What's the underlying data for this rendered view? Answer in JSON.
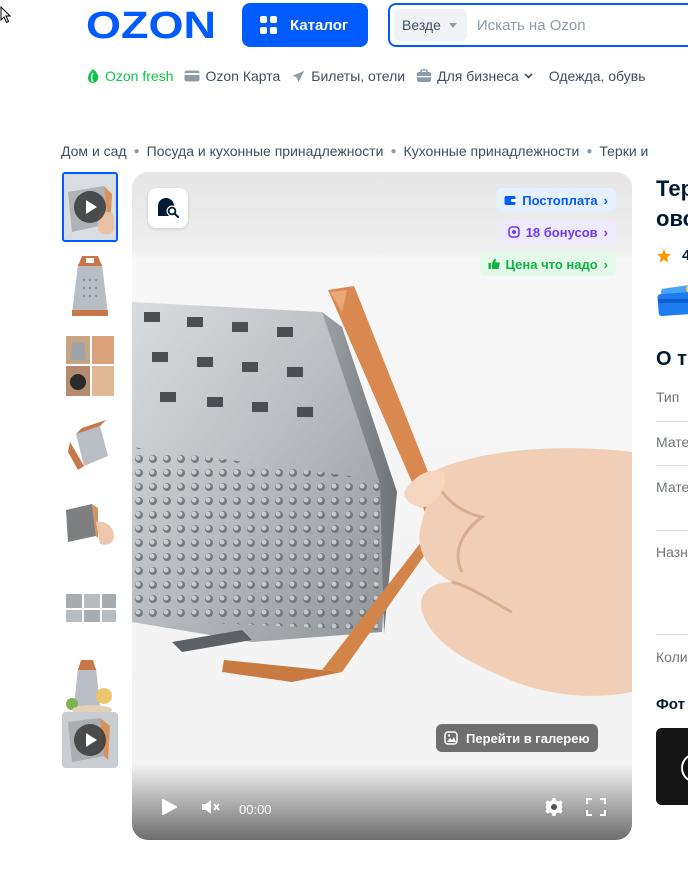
{
  "header": {
    "logo_text": "OZON",
    "catalog_label": "Каталог",
    "search": {
      "scope": "Везде",
      "placeholder": "Искать на Ozon"
    }
  },
  "nav": [
    {
      "label": "Ozon fresh",
      "icon": "fresh-icon"
    },
    {
      "label": "Ozon Карта",
      "icon": "card-icon"
    },
    {
      "label": "Билеты, отели",
      "icon": "plane-icon"
    },
    {
      "label": "Для бизнеса",
      "icon": "business-icon",
      "has_dropdown": true
    },
    {
      "label": "Одежда, обувь",
      "icon": ""
    }
  ],
  "breadcrumb": [
    "Дом и сад",
    "Посуда и кухонные принадлежности",
    "Кухонные принадлежности",
    "Терки и"
  ],
  "gallery": {
    "chips": {
      "postpay": "Постоплата",
      "bonus": "18 бонусов",
      "price": "Цена что надо"
    },
    "gallery_button": "Перейти в галерею",
    "video_time": "00:00",
    "thumbnails": [
      {
        "kind": "video",
        "active": true
      },
      {
        "kind": "image"
      },
      {
        "kind": "image"
      },
      {
        "kind": "image"
      },
      {
        "kind": "image"
      },
      {
        "kind": "image"
      },
      {
        "kind": "image"
      },
      {
        "kind": "video"
      }
    ]
  },
  "product": {
    "title_line1": "Тер",
    "title_line2": "ово",
    "rating": "4",
    "about_heading": "О т",
    "specs": [
      "Тип",
      "Мате",
      "Мате",
      "Назн",
      "Коли"
    ],
    "photos_heading": "Фот"
  },
  "colors": {
    "brand": "#005bff",
    "fresh": "#10c44c",
    "bonus": "#6b3cf0",
    "price_green": "#10b243",
    "star": "#ff9900"
  }
}
